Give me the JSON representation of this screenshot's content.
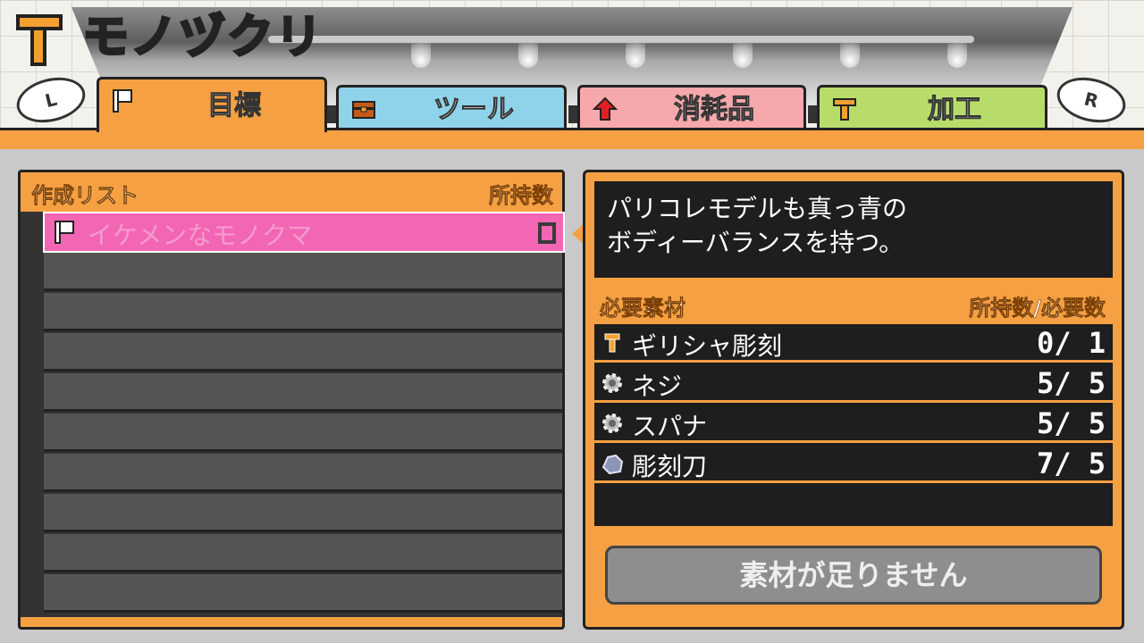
{
  "title": {
    "text": "モノヅクリ",
    "icon": "hammer-icon"
  },
  "shoulder_buttons": {
    "left": "L",
    "right": "R"
  },
  "tabs": [
    {
      "label": "目標",
      "icon": "flag-icon",
      "color": "#f5a043",
      "active": true
    },
    {
      "label": "ツール",
      "icon": "toolbox-icon",
      "color": "#8fd3ea",
      "active": false
    },
    {
      "label": "消耗品",
      "icon": "up-arrow-icon",
      "color": "#f7a8ad",
      "active": false
    },
    {
      "label": "加工",
      "icon": "hammer-icon",
      "color": "#b8dc6a",
      "active": false
    }
  ],
  "list": {
    "title": "作成リスト",
    "count_header": "所持数",
    "items": [
      {
        "name": "イケメンなモノクマ",
        "icon": "flag-icon",
        "count": "0",
        "highlight_color": "#f266b3"
      }
    ],
    "empty_rows": 9
  },
  "detail": {
    "description": "パリコレモデルも真っ青の\nボディーバランスを持つ。",
    "materials_title": "必要素材",
    "materials_count_header": "所持数/必要数",
    "materials": [
      {
        "name": "ギリシャ彫刻",
        "icon": "hammer-icon",
        "owned": "0",
        "needed": "1",
        "count_text": "0/ 1"
      },
      {
        "name": "ネジ",
        "icon": "gear-icon",
        "owned": "5",
        "needed": "5",
        "count_text": "5/ 5"
      },
      {
        "name": "スパナ",
        "icon": "gear-icon",
        "owned": "5",
        "needed": "5",
        "count_text": "5/ 5"
      },
      {
        "name": "彫刻刀",
        "icon": "rock-icon",
        "owned": "7",
        "needed": "5",
        "count_text": "7/ 5"
      }
    ],
    "button_label": "素材が足りません"
  },
  "colors": {
    "accent": "#f5a043",
    "panel_dark": "#1e1e1e",
    "highlight": "#f266b3"
  }
}
